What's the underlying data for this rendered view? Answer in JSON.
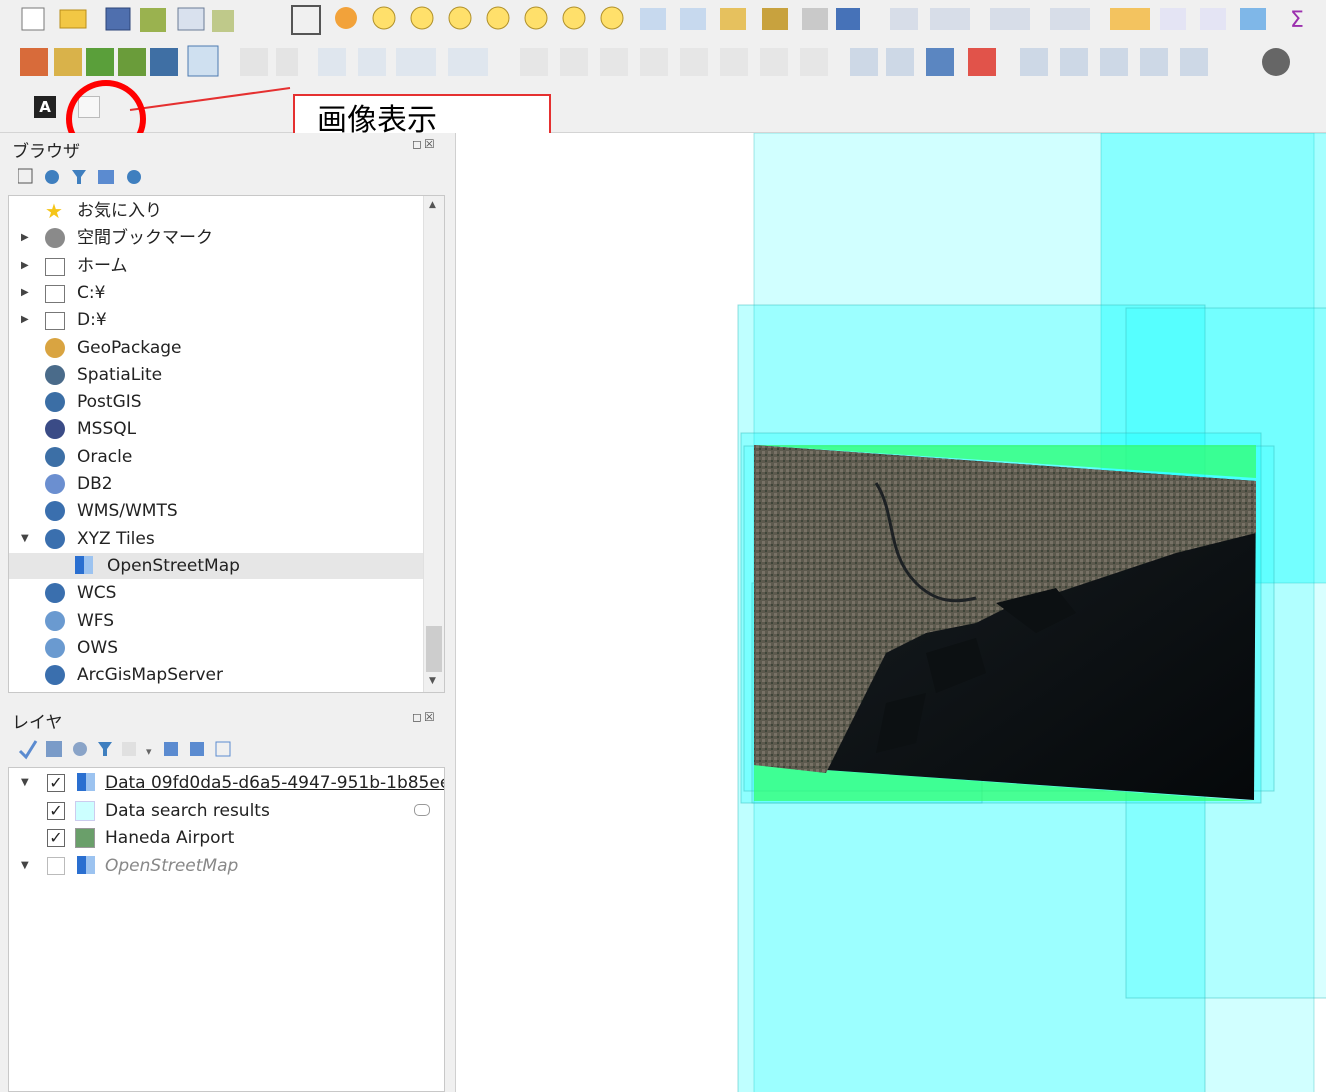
{
  "annotation": {
    "label": "画像表示"
  },
  "colors": {
    "annotation_red": "#ff0000",
    "footprint_cyan": "#00ffff",
    "footprint_green": "#33ff66",
    "selected_row": "#e6e6e6"
  },
  "browser": {
    "title": "ブラウザ",
    "items": [
      {
        "label": "お気に入り",
        "icon": "star-icon",
        "expand": ""
      },
      {
        "label": "空間ブックマーク",
        "icon": "bookmark-icon",
        "expand": "collapsed"
      },
      {
        "label": "ホーム",
        "icon": "home-folder-icon",
        "expand": "collapsed"
      },
      {
        "label": "C:¥",
        "icon": "folder-icon",
        "expand": "collapsed"
      },
      {
        "label": "D:¥",
        "icon": "folder-icon",
        "expand": "collapsed"
      },
      {
        "label": "GeoPackage",
        "icon": "geopackage-icon",
        "expand": ""
      },
      {
        "label": "SpatiaLite",
        "icon": "spatialite-feather-icon",
        "expand": ""
      },
      {
        "label": "PostGIS",
        "icon": "postgis-elephant-icon",
        "expand": ""
      },
      {
        "label": "MSSQL",
        "icon": "mssql-icon",
        "expand": ""
      },
      {
        "label": "Oracle",
        "icon": "oracle-icon",
        "expand": ""
      },
      {
        "label": "DB2",
        "icon": "db2-icon",
        "expand": ""
      },
      {
        "label": "WMS/WMTS",
        "icon": "globe-icon",
        "expand": ""
      },
      {
        "label": "XYZ Tiles",
        "icon": "globe-icon",
        "expand": "expanded"
      },
      {
        "label": "OpenStreetMap",
        "icon": "tiles-icon",
        "expand": ""
      },
      {
        "label": "WCS",
        "icon": "wcs-globe-icon",
        "expand": ""
      },
      {
        "label": "WFS",
        "icon": "wfs-globe-icon",
        "expand": ""
      },
      {
        "label": "OWS",
        "icon": "ows-globe-icon",
        "expand": ""
      },
      {
        "label": "ArcGisMapServer",
        "icon": "arcgis-globe-icon",
        "expand": ""
      }
    ]
  },
  "layers": {
    "title": "レイヤ",
    "items": [
      {
        "label": "Data 09fd0da5-d6a5-4947-951b-1b85ee",
        "checked": true,
        "icon": "tiles-icon",
        "expand": "expanded"
      },
      {
        "label": "Data search results",
        "checked": true,
        "icon": "light-cyan-swatch",
        "expand": ""
      },
      {
        "label": "Haneda Airport",
        "checked": true,
        "icon": "green-swatch",
        "expand": ""
      },
      {
        "label": "OpenStreetMap",
        "checked": false,
        "icon": "tiles-icon",
        "expand": "expanded"
      }
    ]
  }
}
